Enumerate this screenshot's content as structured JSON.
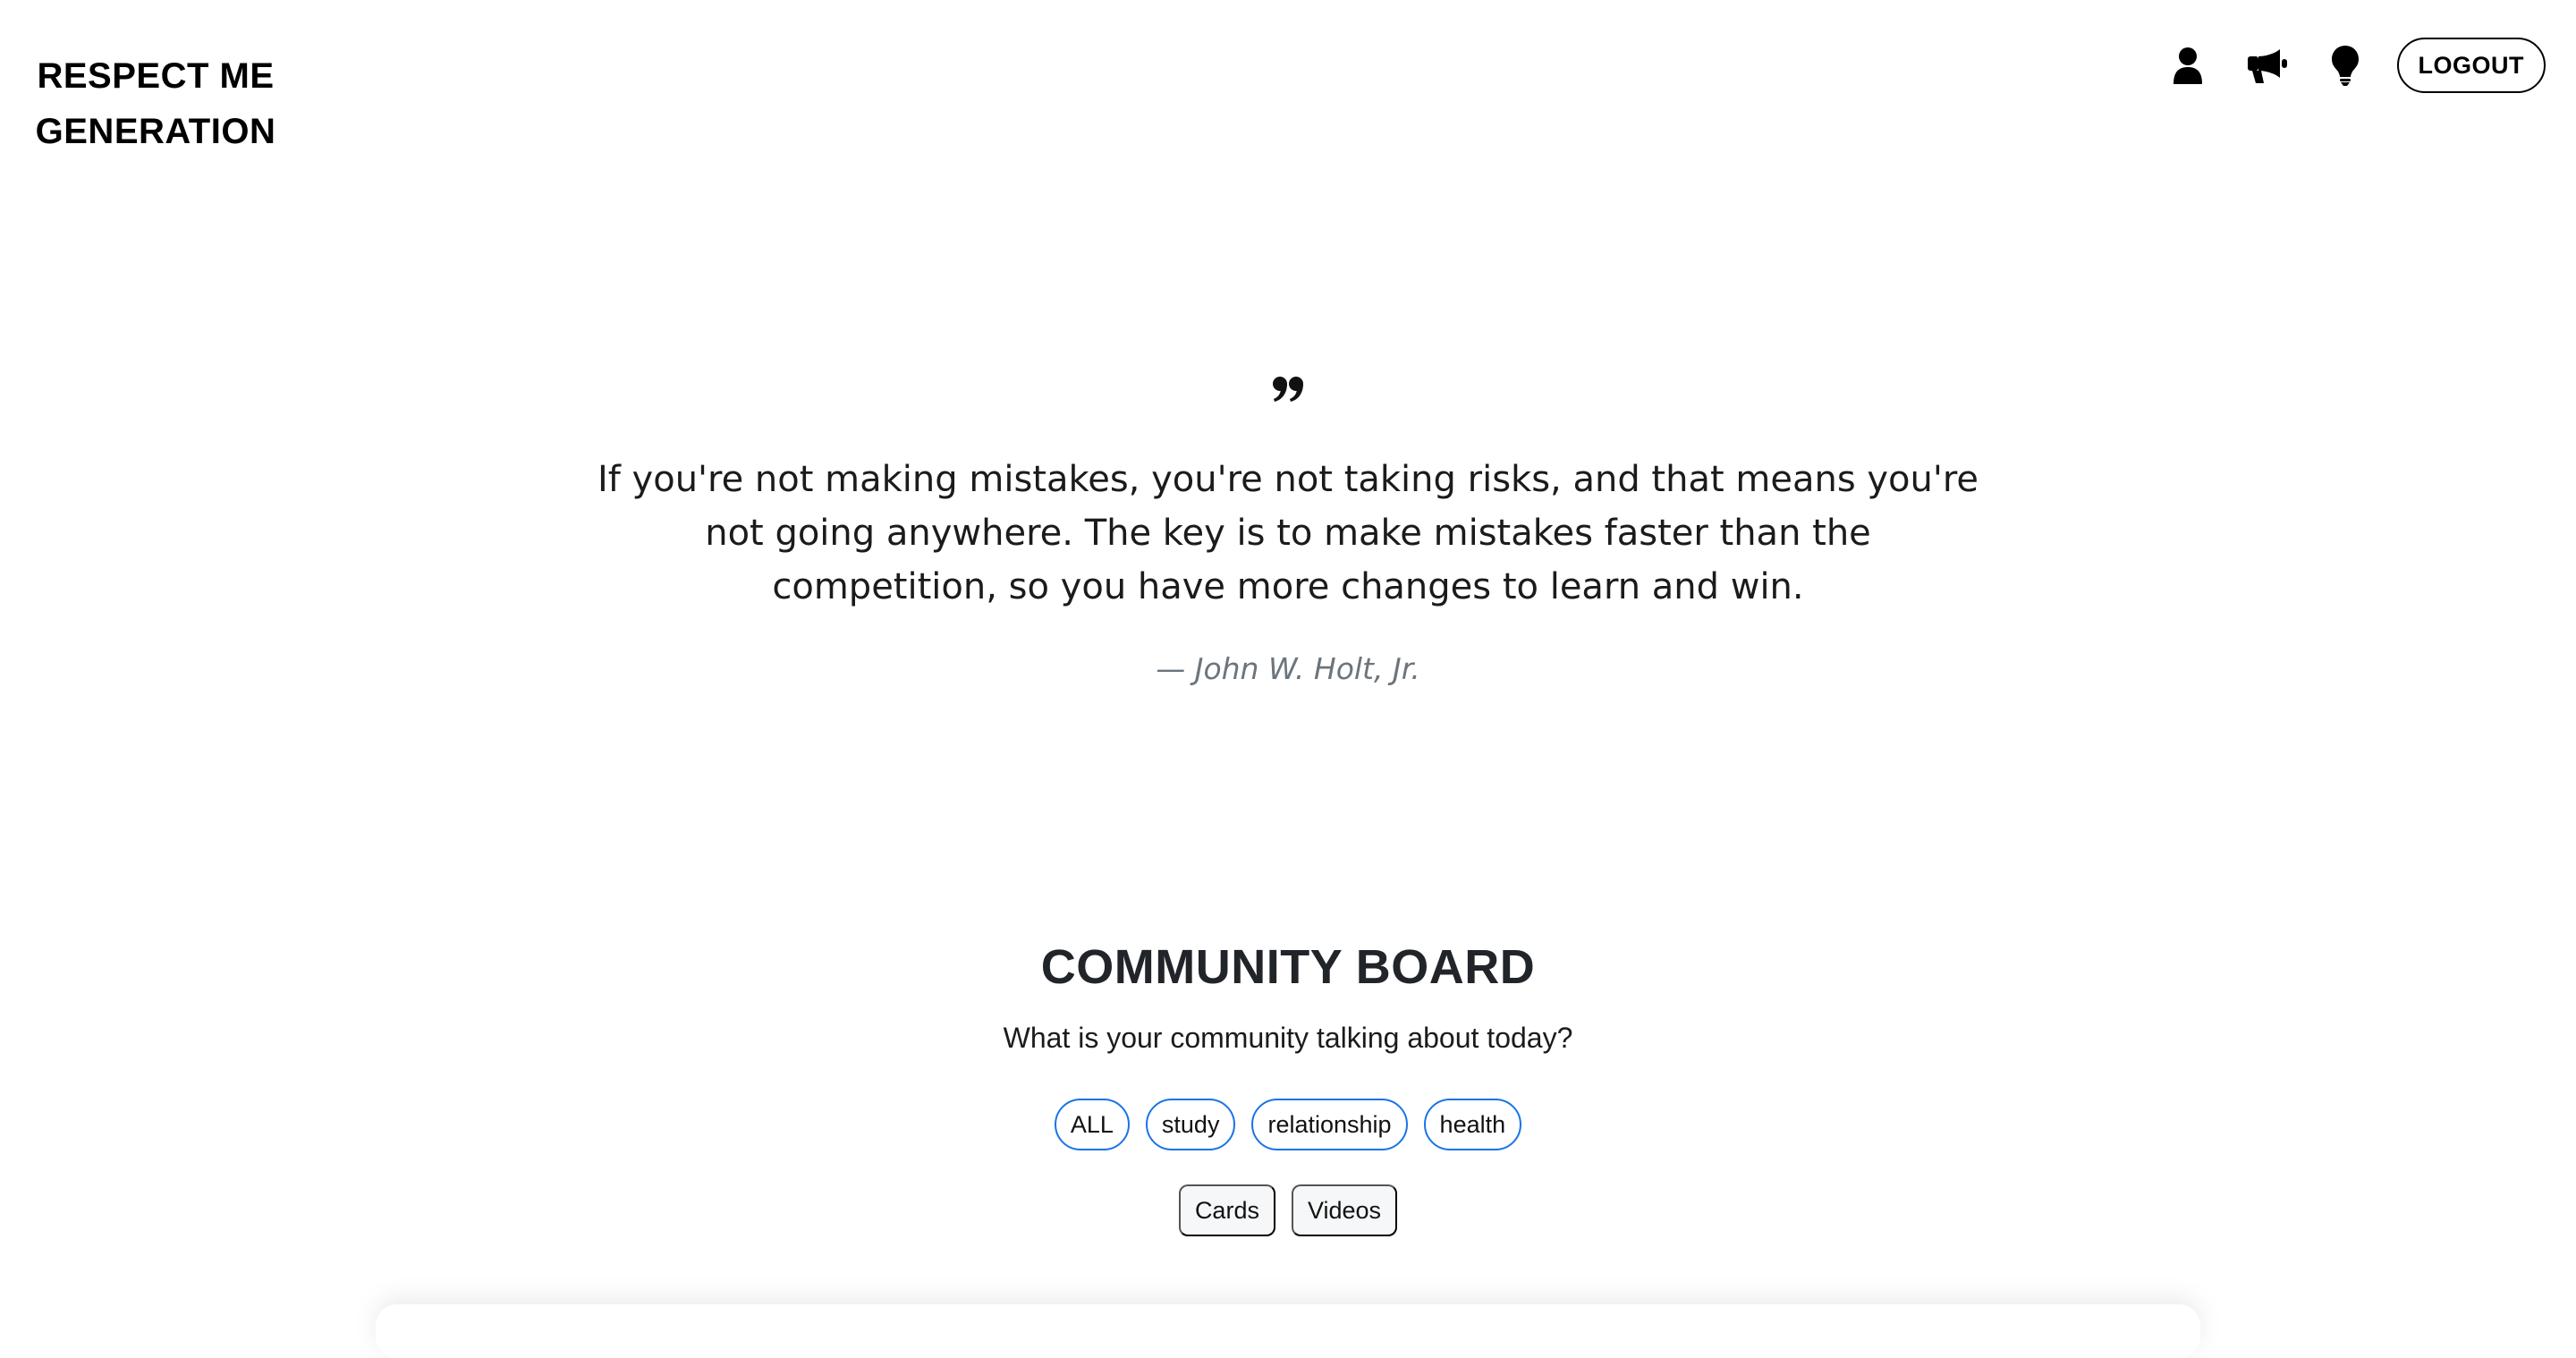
{
  "brand": {
    "line1": "RESPECT ME",
    "line2": "GENERATION"
  },
  "nav": {
    "icons": [
      "user-icon",
      "megaphone-icon",
      "lightbulb-icon"
    ],
    "logout_label": "LOGOUT"
  },
  "quote": {
    "icon": "quote-icon",
    "text": "If you're not making mistakes, you're not taking risks, and that means you're not going anywhere. The key is to make mistakes faster than the competition, so you have more changes to learn and win.",
    "author": "— John W. Holt, Jr."
  },
  "community": {
    "title": "COMMUNITY BOARD",
    "subtitle": "What is your community talking about today?",
    "tags": [
      "ALL",
      "study",
      "relationship",
      "health"
    ],
    "views": [
      "Cards",
      "Videos"
    ]
  },
  "colors": {
    "tag_border": "#1a73e8",
    "author_text": "#6c757d",
    "view_bg": "#f6f7f8"
  }
}
